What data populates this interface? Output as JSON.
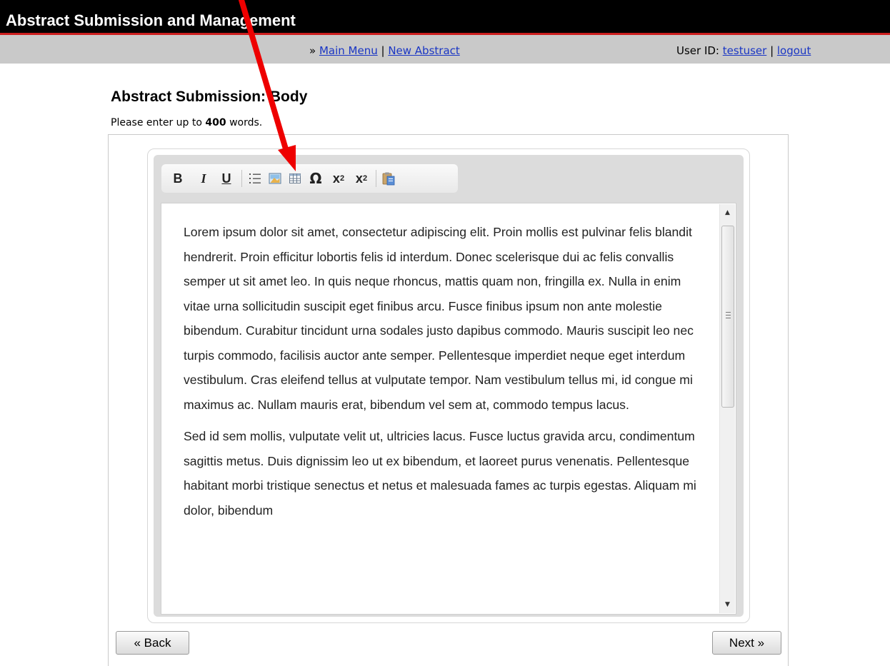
{
  "header": {
    "app_title": "Abstract Submission and Management"
  },
  "nav": {
    "prefix": "» ",
    "main_menu": "Main Menu",
    "separator": " | ",
    "new_abstract": "New Abstract",
    "user_label": "User ID: ",
    "user_id": "testuser",
    "user_sep": " | ",
    "logout": "logout"
  },
  "page": {
    "heading": "Abstract Submission: Body",
    "instructions_before": "Please enter up to ",
    "word_limit": "400",
    "instructions_after": " words."
  },
  "toolbar": {
    "bold": "B",
    "italic": "I",
    "underline": "U",
    "icons": [
      "bullet-list-icon",
      "insert-image-icon",
      "insert-table-icon",
      "special-character-icon",
      "superscript-icon",
      "subscript-icon",
      "paste-word-icon"
    ],
    "omega": "Ω",
    "sup_base": "x",
    "sup_exp": "2",
    "sub_base": "x",
    "sub_exp": "2"
  },
  "editor": {
    "paragraphs": [
      "Lorem ipsum dolor sit amet, consectetur adipiscing elit. Proin mollis est pulvinar felis blandit hendrerit. Proin efficitur lobortis felis id interdum. Donec scelerisque dui ac felis convallis semper ut sit amet leo. In quis neque rhoncus, mattis quam non, fringilla ex. Nulla in enim vitae urna sollicitudin suscipit eget finibus arcu. Fusce finibus ipsum non ante molestie bibendum. Curabitur tincidunt urna sodales justo dapibus commodo. Mauris suscipit leo nec turpis commodo, facilisis auctor ante semper. Pellentesque imperdiet neque eget interdum vestibulum. Cras eleifend tellus at vulputate tempor. Nam vestibulum tellus mi, id congue mi maximus ac. Nullam mauris erat, bibendum vel sem at, commodo tempus lacus.",
      "Sed id sem mollis, vulputate velit ut, ultricies lacus. Fusce luctus gravida arcu, condimentum sagittis metus. Duis dignissim leo ut ex bibendum, et laoreet purus venenatis. Pellentesque habitant morbi tristique senectus et netus et malesuada fames ac turpis egestas. Aliquam mi dolor, bibendum"
    ]
  },
  "buttons": {
    "back": "« Back",
    "next": "Next »"
  },
  "colors": {
    "header_bg": "#000000",
    "header_accent": "#cc1f1f",
    "nav_bg": "#c9c9c9",
    "link": "#1a36c4",
    "annotation_arrow": "#ee0000"
  }
}
